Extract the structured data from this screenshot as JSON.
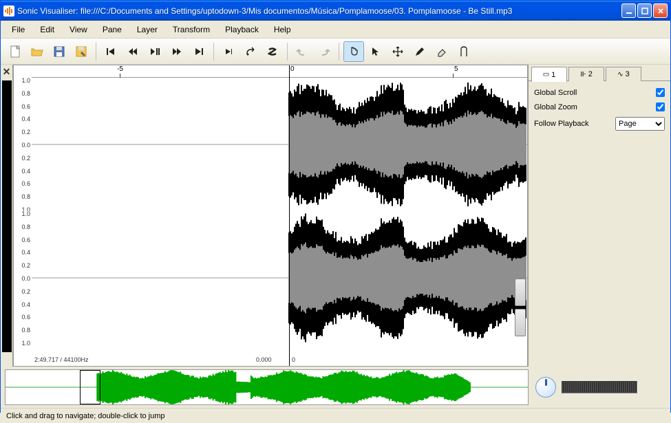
{
  "title": "Sonic Visualiser: file:///C:/Documents and Settings/uptodown-3/Mis documentos/Música/Pomplamoose/03. Pomplamoose - Be Still.mp3",
  "menu": {
    "file": "File",
    "edit": "Edit",
    "view": "View",
    "pane": "Pane",
    "layer": "Layer",
    "transform": "Transform",
    "playback": "Playback",
    "help": "Help"
  },
  "ruler": {
    "tick_minus5": "-5",
    "tick_0": "0",
    "tick_5": "5"
  },
  "yticks": [
    "1.0",
    "0.8",
    "0.6",
    "0.4",
    "0.2",
    "0.0",
    "0.2",
    "0.4",
    "0.6",
    "0.8",
    "1.0"
  ],
  "info": {
    "left": "2:49.717 / 44100Hz",
    "center": "0.000",
    "right": "0"
  },
  "tabs": {
    "t1": "1",
    "t2": "2",
    "t3": "3"
  },
  "props": {
    "global_scroll_label": "Global Scroll",
    "global_scroll_checked": "true",
    "global_zoom_label": "Global Zoom",
    "global_zoom_checked": "true",
    "follow_playback_label": "Follow Playback",
    "follow_playback_value": "Page"
  },
  "status": "Click and drag to navigate; double-click to jump"
}
